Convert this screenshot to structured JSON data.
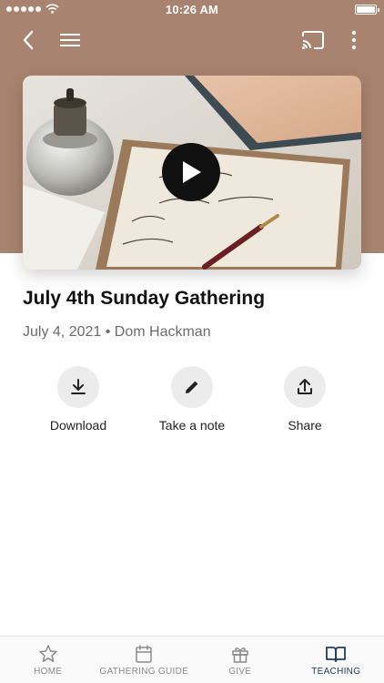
{
  "status": {
    "time": "10:26 AM"
  },
  "nav": {
    "back_icon": "chevron-left-icon",
    "menu_icon": "hamburger-icon",
    "cast_icon": "cast-icon",
    "more_icon": "more-vertical-icon"
  },
  "video": {
    "play_icon": "play-icon"
  },
  "episode": {
    "title": "July 4th Sunday Gathering",
    "date": "July 4, 2021",
    "separator": "•",
    "speaker": "Dom Hackman"
  },
  "actions": [
    {
      "label": "Download",
      "icon": "download-icon"
    },
    {
      "label": "Take a note",
      "icon": "pencil-icon"
    },
    {
      "label": "Share",
      "icon": "share-icon"
    }
  ],
  "tabs": [
    {
      "label": "HOME",
      "icon": "star-icon"
    },
    {
      "label": "GATHERING GUIDE",
      "icon": "calendar-icon"
    },
    {
      "label": "GIVE",
      "icon": "gift-icon"
    },
    {
      "label": "TEACHING",
      "icon": "book-icon",
      "active": true
    }
  ],
  "colors": {
    "header_bg": "#a8836f",
    "accent": "#213b5e",
    "action_bg": "#ececec"
  }
}
